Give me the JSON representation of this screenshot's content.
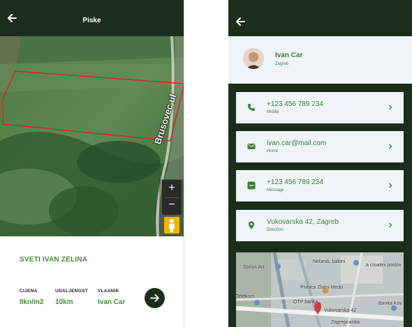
{
  "left_screen": {
    "header": {
      "title": "Piske"
    },
    "map": {
      "road_label": "Brusovec ul"
    },
    "parcel": {
      "location": "SVETI IVAN ZELINA",
      "fields": [
        {
          "label": "CIJENA",
          "value": "8kn/m2"
        },
        {
          "label": "UDALJENOST",
          "value": "10km"
        },
        {
          "label": "VLASNIK",
          "value": "Ivan Car"
        }
      ]
    }
  },
  "right_screen": {
    "profile": {
      "name": "Ivan Car",
      "city": "Zagreb"
    },
    "contacts": [
      {
        "value": "+123 456 789 234",
        "type": "Mobile",
        "icon": "phone-icon"
      },
      {
        "value": "ivan.car@mail.com",
        "type": "Home",
        "icon": "mail-icon"
      },
      {
        "value": "+123 456 789 234",
        "type": "Message",
        "icon": "message-icon"
      },
      {
        "value": "Vukovarska 42, Zagreb",
        "type": "Direction",
        "icon": "location-icon"
      }
    ],
    "mini_map_labels": [
      "Nebesk. baloni",
      "Sorius Art",
      "Pivnica Zlatni Medo",
      "Telekom",
      "OTP banka",
      "Vukovarska 42",
      "Banka Kov",
      "a cruatini poslov",
      "Zagrepcanka"
    ]
  },
  "colors": {
    "header_bg": "#1b2e1c",
    "accent_green": "#4a8a3d",
    "card_bg": "#eef4f8",
    "parcel_outline": "#d0262a"
  }
}
